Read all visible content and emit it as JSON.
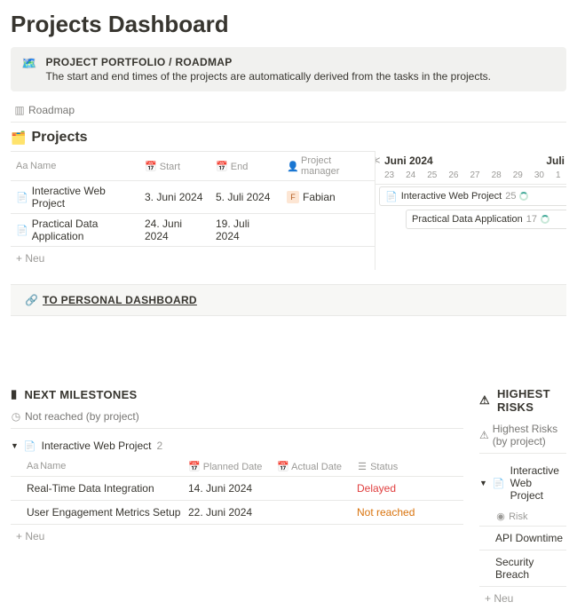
{
  "title": "Projects Dashboard",
  "callout": {
    "title": "PROJECT PORTFOLIO / ROADMAP",
    "subtitle": "The start and end times of the projects are automatically derived from the tasks in the projects."
  },
  "roadmap_tab": "Roadmap",
  "projects_heading": "Projects",
  "table": {
    "headers": {
      "name": "Name",
      "start": "Start",
      "end": "End",
      "pm": "Project manager"
    },
    "rows": [
      {
        "name": "Interactive Web Project",
        "start": "3. Juni 2024",
        "end": "5. Juli 2024",
        "pm_initial": "F",
        "pm": "Fabian"
      },
      {
        "name": "Practical Data Application",
        "start": "24. Juni 2024",
        "end": "19. Juli 2024",
        "pm_initial": "",
        "pm": ""
      }
    ],
    "new": "Neu"
  },
  "timeline": {
    "month": "Juni 2024",
    "month2": "Juli",
    "days": [
      "23",
      "24",
      "25",
      "26",
      "27",
      "28",
      "29",
      "30",
      "1"
    ],
    "bars": [
      {
        "name": "Interactive Web Project",
        "count": "25"
      },
      {
        "name": "Practical Data Application",
        "count": "17"
      }
    ]
  },
  "personal_link": "TO PERSONAL DASHBOARD",
  "milestones": {
    "heading": "NEXT MILESTONES",
    "view": "Not reached (by project)",
    "group": {
      "name": "Interactive Web Project",
      "count": "2"
    },
    "headers": {
      "name": "Name",
      "planned": "Planned Date",
      "actual": "Actual Date",
      "status": "Status"
    },
    "rows": [
      {
        "name": "Real-Time Data Integration",
        "planned": "14. Juni 2024",
        "actual": "",
        "status": "Delayed",
        "cls": "st-delayed"
      },
      {
        "name": "User Engagement Metrics Setup",
        "planned": "22. Juni 2024",
        "actual": "",
        "status": "Not reached",
        "cls": "st-notreached"
      }
    ],
    "new": "Neu"
  },
  "risks": {
    "heading": "HIGHEST RISKS",
    "view": "Highest Risks (by project)",
    "group": "Interactive Web Project",
    "header": "Risk",
    "rows": [
      "API Downtime",
      "Security Breach"
    ],
    "new": "Neu"
  }
}
